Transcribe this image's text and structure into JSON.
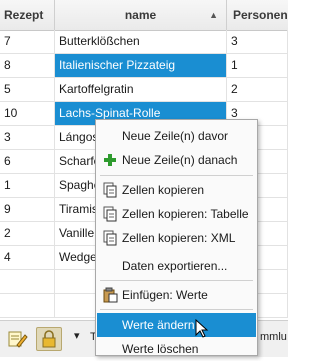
{
  "table": {
    "columns": [
      {
        "label": "Rezept"
      },
      {
        "label": "name",
        "sort": "ascending"
      },
      {
        "label": "Personen"
      }
    ],
    "rows": [
      {
        "rezept": "7",
        "name": "Butterklößchen",
        "personen": "3",
        "selected": false
      },
      {
        "rezept": "8",
        "name": "Italienischer Pizzateig",
        "personen": "1",
        "selected": true
      },
      {
        "rezept": "5",
        "name": "Kartoffelgratin",
        "personen": "2",
        "selected": false
      },
      {
        "rezept": "10",
        "name": "Lachs-Spinat-Rolle",
        "personen": "3",
        "selected": true
      },
      {
        "rezept": "3",
        "name": "Lángos",
        "personen": "",
        "selected": false
      },
      {
        "rezept": "6",
        "name": "Scharfe",
        "personen": "",
        "selected": false
      },
      {
        "rezept": "1",
        "name": "Spaghe",
        "personen": "",
        "selected": false
      },
      {
        "rezept": "9",
        "name": "Tiramis",
        "personen": "",
        "selected": false
      },
      {
        "rezept": "2",
        "name": "Vanille",
        "personen": "",
        "selected": false
      },
      {
        "rezept": "4",
        "name": "Wedge",
        "personen": "",
        "selected": false
      },
      {
        "rezept": "",
        "name": "",
        "personen": "",
        "selected": false
      },
      {
        "rezept": "",
        "name": "",
        "personen": "",
        "selected": false
      }
    ]
  },
  "context_menu": {
    "items": [
      {
        "label": "Neue Zeile(n) davor",
        "icon": "none"
      },
      {
        "label": "Neue Zeile(n) danach",
        "icon": "plus-icon"
      },
      {
        "label": "Zellen kopieren",
        "icon": "copy-icon"
      },
      {
        "label": "Zellen kopieren: Tabelle",
        "icon": "copy-icon"
      },
      {
        "label": "Zellen kopieren: XML",
        "icon": "copy-icon"
      },
      {
        "label": "Daten exportieren...",
        "icon": "none"
      },
      {
        "label": "Einfügen: Werte",
        "icon": "paste-icon"
      },
      {
        "label": "Werte ändern...",
        "icon": "none",
        "highlighted": true
      },
      {
        "label": "Werte löschen",
        "icon": "none"
      }
    ]
  },
  "toolbar": {
    "dropdown_glyph": "▾",
    "label_left": "T",
    "label_right": "mmlu"
  },
  "colors": {
    "selection": "#1a8ed2",
    "menu_highlight": "#1a8ed2",
    "plus_icon": "#2e9b2e"
  }
}
